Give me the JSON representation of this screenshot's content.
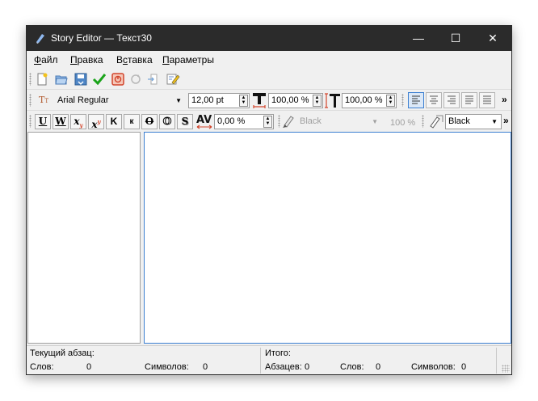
{
  "window": {
    "title": "Story Editor — Текст30",
    "controls": {
      "minimize": "—",
      "maximize": "☐",
      "close": "✕"
    }
  },
  "menu": [
    {
      "first": "Ф",
      "rest": "айл"
    },
    {
      "first": "П",
      "rest": "равка"
    },
    {
      "pre": "В",
      "first": "с",
      "rest": "тавка"
    },
    {
      "first": "П",
      "rest": "араметры"
    }
  ],
  "toolbar_main": {
    "icons": [
      "new-document-icon",
      "open-folder-icon",
      "save-icon",
      "checkmark-icon",
      "stop-icon",
      "refresh-icon",
      "import-icon",
      "edit-icon"
    ]
  },
  "toolbar_font": {
    "font_family": "Arial Regular",
    "font_size": "12,00 pt",
    "vertical_scale": "100,00 %",
    "horizontal_scale": "100,00 %",
    "overflow": "»"
  },
  "toolbar_style": {
    "buttons": [
      "U",
      "W",
      "x",
      "x",
      "K",
      "к",
      "O",
      "O",
      "S"
    ],
    "tracking": "0,00 %",
    "fill_color": "Black",
    "fill_tint": "100 %",
    "stroke_color": "Black",
    "overflow": "»"
  },
  "status": {
    "current_paragraph_label": "Текущий абзац:",
    "words_label": "Слов:",
    "words_value": "0",
    "chars_label": "Символов:",
    "chars_value": "0",
    "total_label": "Итого:",
    "paragraphs_label": "Абзацев:",
    "paragraphs_value": "0",
    "total_words_label": "Слов:",
    "total_words_value": "0",
    "total_chars_label": "Символов:",
    "total_chars_value": "0"
  },
  "colors": {
    "titlebar": "#2b2b2b",
    "accent": "#3c7fd1",
    "check": "#1aa31a",
    "stop": "#d2452c"
  }
}
